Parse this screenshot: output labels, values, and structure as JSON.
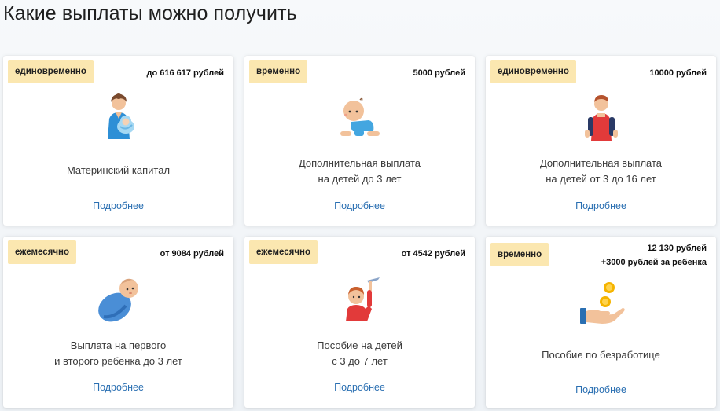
{
  "page": {
    "title": "Какие выплаты можно получить"
  },
  "cards": [
    {
      "badge": "единовременно",
      "amount_line1": "до 616 617 рублей",
      "desc_line1": "Материнский капитал",
      "desc_line2": "",
      "link": "Подробнее",
      "icon": "mother-with-baby-icon"
    },
    {
      "badge": "временно",
      "amount_line1": "5000 рублей",
      "desc_line1": "Дополнительная выплата",
      "desc_line2": "на детей до 3 лет",
      "link": "Подробнее",
      "icon": "crawling-baby-icon"
    },
    {
      "badge": "единовременно",
      "amount_line1": "10000 рублей",
      "desc_line1": "Дополнительная выплата",
      "desc_line2": "на детей от 3 до 16 лет",
      "link": "Подробнее",
      "icon": "schoolboy-with-backpack-icon"
    },
    {
      "badge": "ежемесячно",
      "amount_line1": "от 9084 рублей",
      "desc_line1": "Выплата на первого",
      "desc_line2": "и второго ребенка до 3 лет",
      "link": "Подробнее",
      "icon": "swaddled-baby-icon"
    },
    {
      "badge": "ежемесячно",
      "amount_line1": "от 4542 рублей",
      "desc_line1": "Пособие на детей",
      "desc_line2": "с 3 до 7 лет",
      "link": "Подробнее",
      "icon": "child-with-toy-plane-icon"
    },
    {
      "badge": "временно",
      "amount_line1": "12 130 рублей",
      "amount_line2": "+3000 рублей за ребенка",
      "desc_line1": "Пособие по безработице",
      "desc_line2": "",
      "link": "Подробнее",
      "icon": "hand-with-coins-icon"
    }
  ],
  "colors": {
    "badge_bg": "#fbe7b0",
    "link": "#2a6fb2"
  }
}
